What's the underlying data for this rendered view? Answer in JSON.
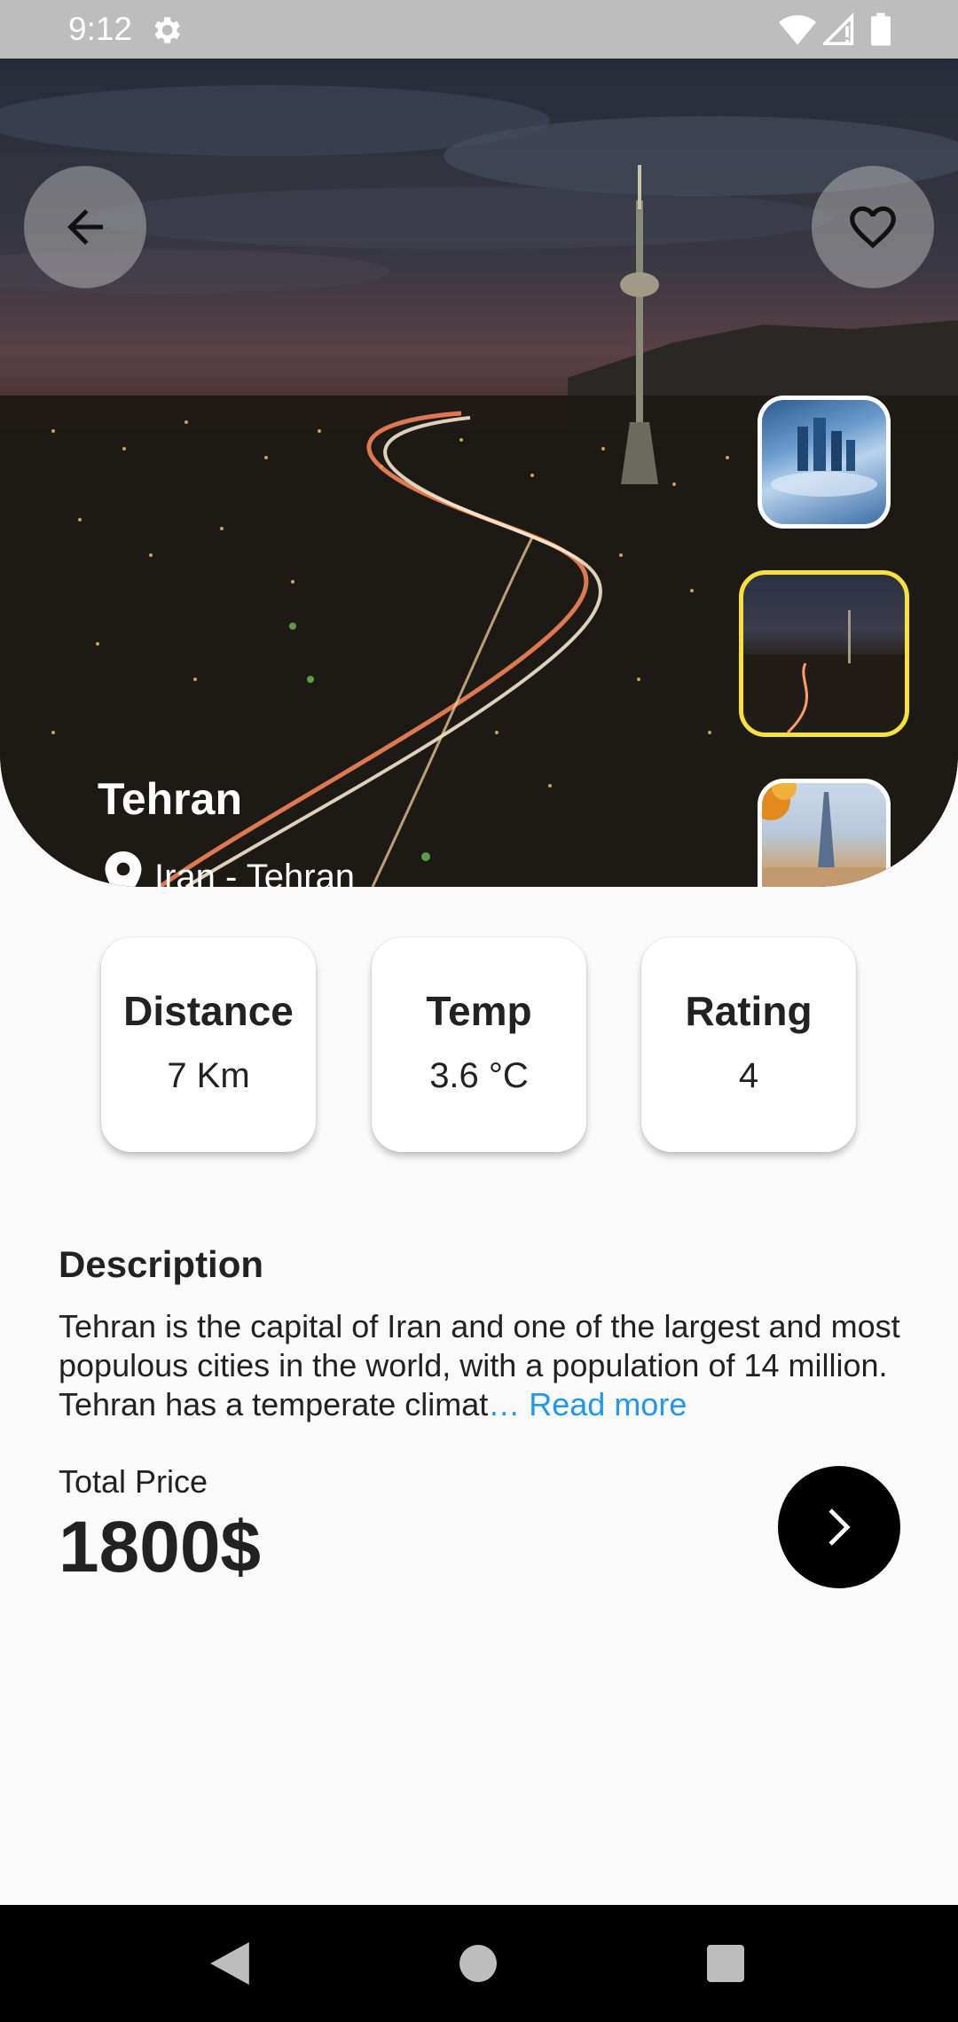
{
  "status_bar": {
    "time": "9:12",
    "icons": [
      "gear-icon",
      "wifi-icon",
      "signal-icon",
      "battery-icon"
    ]
  },
  "hero": {
    "title": "Tehran",
    "location": "Iran - Tehran",
    "back_icon": "arrow-left-icon",
    "favorite_icon": "heart-outline-icon",
    "thumbnails": [
      {
        "name": "city-skyline-thumbnail",
        "selected": false
      },
      {
        "name": "tehran-night-thumbnail",
        "selected": true
      },
      {
        "name": "paris-eiffel-thumbnail",
        "selected": false
      }
    ],
    "selected_border_color": "#f7e23b"
  },
  "stats": [
    {
      "label": "Distance",
      "value": "7 Km"
    },
    {
      "label": "Temp",
      "value": "3.6 °C"
    },
    {
      "label": "Rating",
      "value": "4"
    }
  ],
  "description": {
    "title": "Description",
    "text": "Tehran is the capital of Iran and one of the largest and most populous cities in the world, with a population of 14 million. Tehran has a temperate climat",
    "ellipsis": "…",
    "read_more": " Read more",
    "link_color": "#2196f3"
  },
  "price": {
    "label": "Total Price",
    "value": "1800$",
    "next_icon": "chevron-right-icon"
  },
  "nav_bar": {
    "icons": [
      "nav-back-icon",
      "nav-home-icon",
      "nav-recents-icon"
    ]
  }
}
